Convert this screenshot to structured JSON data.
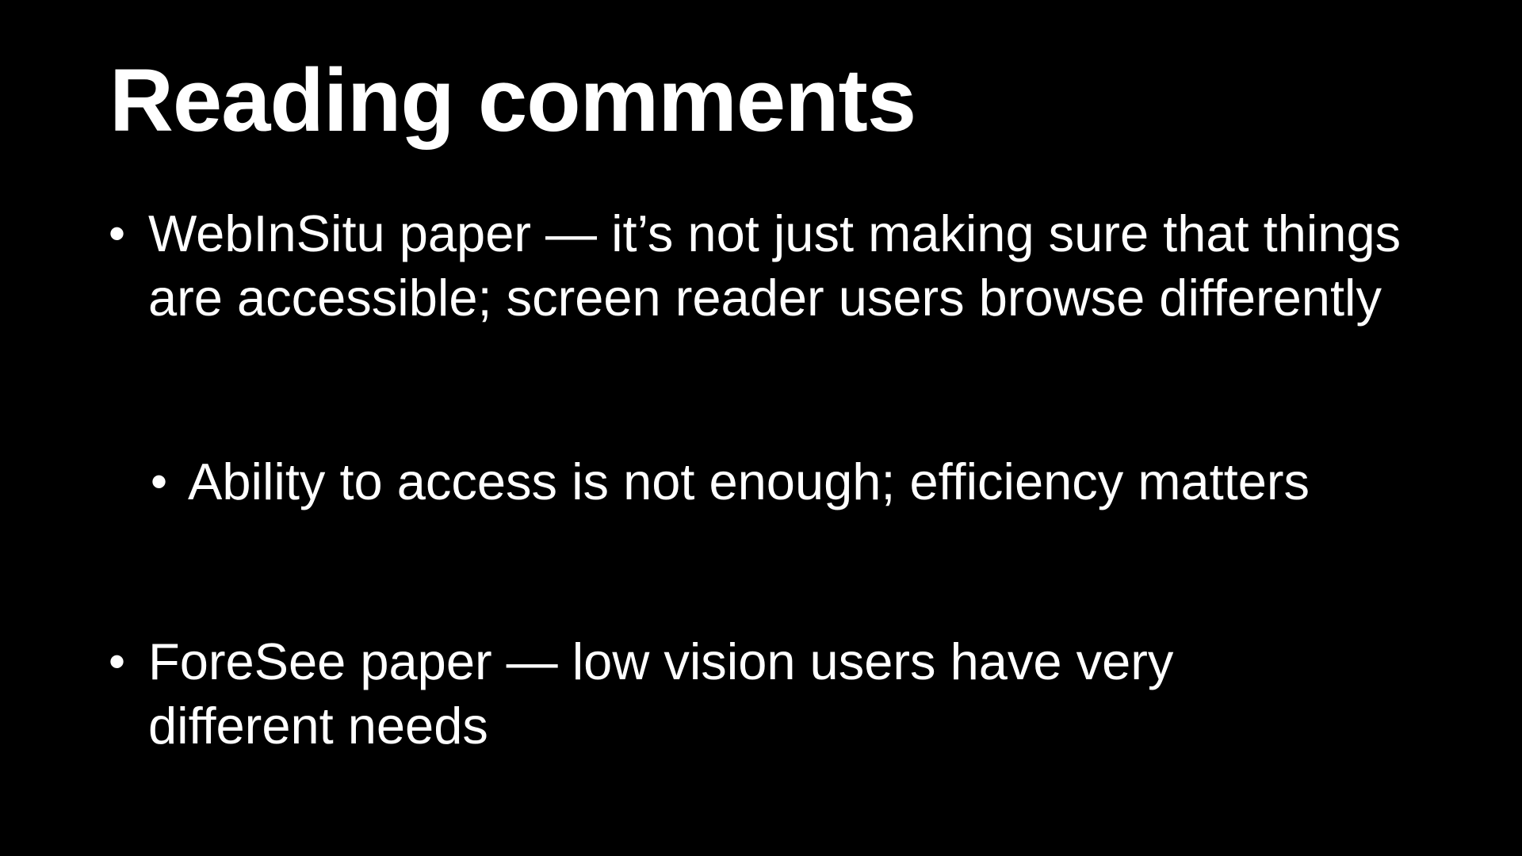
{
  "slide": {
    "title": "Reading comments",
    "bullets": [
      {
        "marker": "•",
        "text": "WebInSitu paper — it’s not just making sure that things are accessible; screen reader users browse differently"
      },
      {
        "marker": "•",
        "text": "Ability to access is not enough; efficiency matters"
      },
      {
        "marker": "•",
        "text": "ForeSee paper — low vision users have very different needs"
      }
    ]
  },
  "colors": {
    "background": "#000000",
    "text": "#ffffff"
  }
}
